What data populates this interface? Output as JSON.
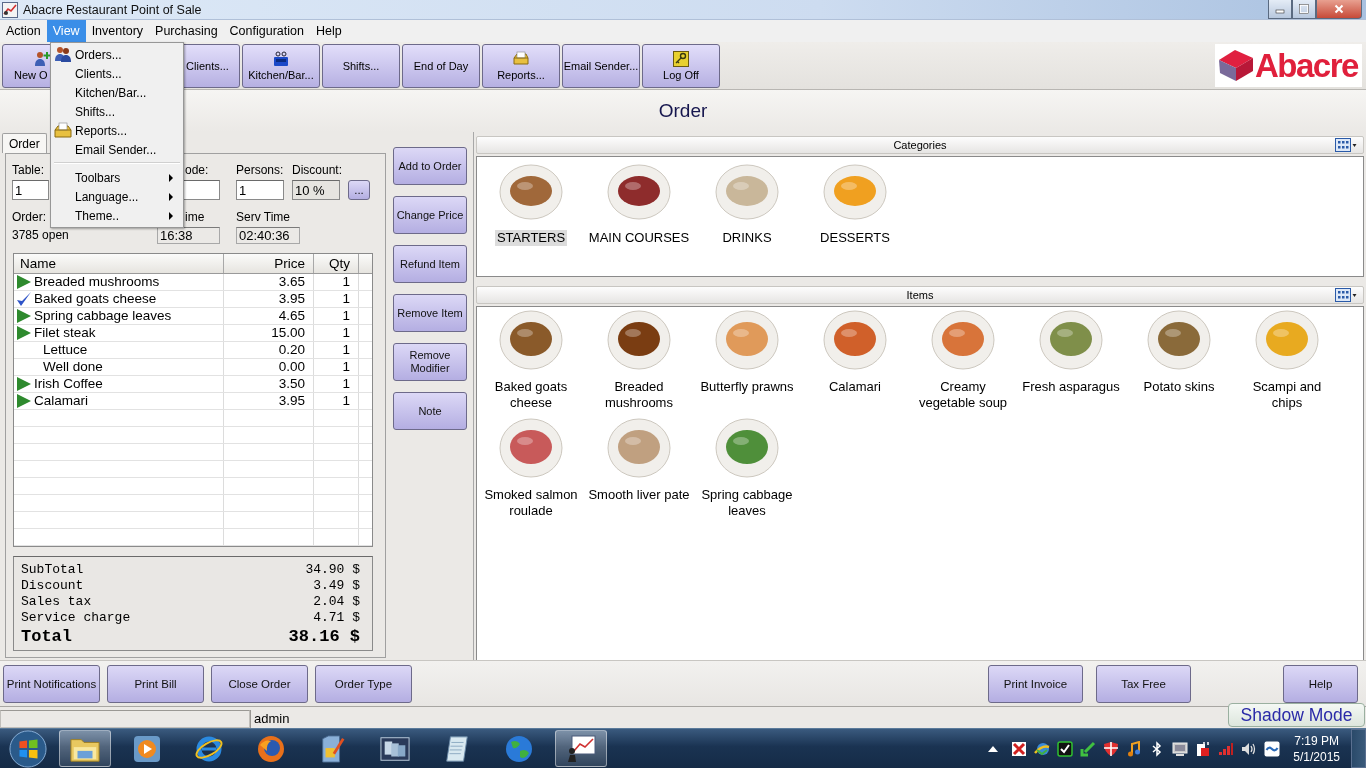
{
  "window": {
    "title": "Abacre Restaurant Point of Sale"
  },
  "menu_bar": [
    {
      "label": "Action",
      "selected": false
    },
    {
      "label": "View",
      "selected": true
    },
    {
      "label": "Inventory",
      "selected": false
    },
    {
      "label": "Purchasing",
      "selected": false
    },
    {
      "label": "Configuration",
      "selected": false
    },
    {
      "label": "Help",
      "selected": false
    }
  ],
  "view_menu": {
    "groups": [
      [
        {
          "label": "Orders...",
          "submenu": false
        },
        {
          "label": "Clients...",
          "submenu": false
        },
        {
          "label": "Kitchen/Bar...",
          "submenu": false
        },
        {
          "label": "Shifts...",
          "submenu": false
        },
        {
          "label": "Reports...",
          "submenu": false
        },
        {
          "label": "Email Sender...",
          "submenu": false
        }
      ],
      [
        {
          "label": "Toolbars",
          "submenu": true
        },
        {
          "label": "Language...",
          "submenu": true
        },
        {
          "label": "Theme..",
          "submenu": true
        }
      ]
    ]
  },
  "toolbar": {
    "buttons": [
      {
        "label": "New O"
      },
      {
        "label": "Clients..."
      },
      {
        "label": "Kitchen/Bar..."
      },
      {
        "label": "Shifts..."
      },
      {
        "label": "End of Day"
      },
      {
        "label": "Reports..."
      },
      {
        "label": "Email Sender..."
      },
      {
        "label": "Log Off"
      }
    ],
    "logo": "Abacre"
  },
  "page_title": "Order",
  "order_panel": {
    "tabs": [
      {
        "label": "Order",
        "selected": true
      }
    ],
    "fields": [
      {
        "label": "Table:",
        "value": "1",
        "disabled": false
      },
      {
        "label": "ode:",
        "disabled": false
      },
      {
        "label": "Persons:",
        "value": "1",
        "disabled": false
      },
      {
        "label": "Discount:",
        "value": "10 %",
        "disabled": true
      }
    ],
    "more_button": "...",
    "info": [
      {
        "label": "Order:",
        "value": "3785 open",
        "kind": "text"
      },
      {
        "label": "ime",
        "value": "16:38",
        "kind": "field"
      },
      {
        "label": "Serv Time",
        "value": "02:40:36",
        "kind": "field"
      }
    ],
    "table": {
      "columns": [
        "Name",
        "Price",
        "Qty"
      ],
      "rows": [
        {
          "name": "Breaded mushrooms",
          "price": "3.65",
          "qty": "1",
          "checked": false
        },
        {
          "name": "Baked goats cheese",
          "price": "3.95",
          "qty": "1",
          "checked": true
        },
        {
          "name": "Spring cabbage leaves",
          "price": "4.65",
          "qty": "1",
          "checked": false
        },
        {
          "name": "Filet steak",
          "price": "15.00",
          "qty": "1",
          "checked": false,
          "children": [
            {
              "name": "Lettuce",
              "price": "0.20",
              "qty": "1"
            },
            {
              "name": "Well done",
              "price": "0.00",
              "qty": "1"
            }
          ]
        },
        {
          "name": "Irish Coffee",
          "price": "3.50",
          "qty": "1",
          "checked": false
        },
        {
          "name": "Calamari",
          "price": "3.95",
          "qty": "1",
          "checked": false
        }
      ]
    },
    "totals": [
      {
        "label": "SubTotal",
        "value": "34.90 $",
        "kind": "line"
      },
      {
        "label": "Discount",
        "value": "3.49 $",
        "kind": "line"
      },
      {
        "label": "Sales tax",
        "value": "2.04 $",
        "kind": "line"
      },
      {
        "label": "Service charge",
        "value": "4.71 $",
        "kind": "line"
      },
      {
        "label": "Total",
        "value": "38.16 $",
        "kind": "total"
      }
    ]
  },
  "actions": [
    "Add to Order",
    "Change Price",
    "Refund Item",
    "Remove Item",
    "Remove Modifier",
    "Note"
  ],
  "categories": {
    "title": "Categories",
    "items": [
      {
        "label": "STARTERS",
        "selected": true
      },
      {
        "label": "MAIN COURSES",
        "selected": false
      },
      {
        "label": "DRINKS",
        "selected": false
      },
      {
        "label": "DESSERTS",
        "selected": false
      }
    ]
  },
  "items": {
    "title": "Items",
    "items": [
      {
        "label": "Baked goats\ncheese"
      },
      {
        "label": "Breaded\nmushrooms"
      },
      {
        "label": "Butterfly prawns"
      },
      {
        "label": "Calamari"
      },
      {
        "label": "Creamy\nvegetable soup"
      },
      {
        "label": "Fresh asparagus"
      },
      {
        "label": "Potato skins"
      },
      {
        "label": "Scampi and\nchips"
      },
      {
        "label": "Smoked salmon\nroulade"
      },
      {
        "label": "Smooth liver pate"
      },
      {
        "label": "Spring cabbage\nleaves"
      }
    ]
  },
  "bottom_bar": {
    "left": [
      "Print Notifications",
      "Print Bill",
      "Close Order",
      "Order Type"
    ],
    "right": [
      "Print Invoice",
      "Tax Free"
    ],
    "help": "Help"
  },
  "status_bar": {
    "user": "admin"
  },
  "shadow_mode": "Shadow Mode",
  "taskbar": {
    "apps": [
      {
        "active": true
      },
      {
        "active": false
      },
      {
        "active": false
      },
      {
        "active": false
      },
      {
        "active": false
      },
      {
        "active": false
      },
      {
        "active": false
      },
      {
        "active": false
      },
      {
        "active": true
      }
    ],
    "clock": {
      "time": "7:19 PM",
      "date": "5/1/2015"
    }
  }
}
